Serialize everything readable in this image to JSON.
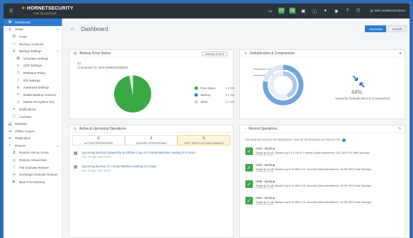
{
  "topbar": {
    "menu_icon": "hamburger-icon",
    "brand_name": "HORNETSECURITY",
    "brand_product": "VM BACKUP",
    "icons": [
      "monitor-icon",
      "cloud-icon",
      "console-icon",
      "info-icon",
      "bell-icon",
      "user-icon",
      "help-icon",
      "power-icon",
      "server-icon"
    ],
    "status_badge_1": "CP",
    "status_badge_2": "OK",
    "server_name": "WIN-20MB10OOEWI"
  },
  "sidebar": {
    "items": [
      {
        "label": "Dashboard",
        "icon": "dashboard-icon",
        "level": 1,
        "active": true,
        "chevron": ""
      },
      {
        "label": "Setup",
        "icon": "gear-icon",
        "level": 1,
        "active": false,
        "chevron": "▾"
      },
      {
        "label": "Hosts",
        "icon": "server-icon",
        "level": 2,
        "active": false,
        "chevron": ""
      },
      {
        "label": "Backup Locations",
        "icon": "folder-icon",
        "level": 2,
        "active": false,
        "chevron": ""
      },
      {
        "label": "Backup Settings",
        "icon": "gear-icon",
        "level": 2,
        "active": false,
        "chevron": "▾"
      },
      {
        "label": "Schedule Settings",
        "icon": "calendar-icon",
        "level": 3,
        "active": false,
        "chevron": ""
      },
      {
        "label": "CDP Settings",
        "icon": "refresh-icon",
        "level": 3,
        "active": false,
        "chevron": ""
      },
      {
        "label": "Retention Policy",
        "icon": "clock-icon",
        "level": 3,
        "active": false,
        "chevron": ""
      },
      {
        "label": "IFD Settings",
        "icon": "file-icon",
        "level": 3,
        "active": false,
        "chevron": ""
      },
      {
        "label": "Advanced Settings",
        "icon": "gear-icon",
        "level": 3,
        "active": false,
        "chevron": ""
      },
      {
        "label": "Delete Backup Versions",
        "icon": "trash-icon",
        "level": 3,
        "active": false,
        "chevron": ""
      },
      {
        "label": "Master Encryption Key",
        "icon": "key-icon",
        "level": 3,
        "active": false,
        "chevron": ""
      },
      {
        "label": "Notifications",
        "icon": "bell-icon",
        "level": 2,
        "active": false,
        "chevron": ""
      },
      {
        "label": "Licenses",
        "icon": "license-icon",
        "level": 2,
        "active": false,
        "chevron": ""
      },
      {
        "label": "Backups",
        "icon": "backup-icon",
        "level": 1,
        "active": false,
        "chevron": ""
      },
      {
        "label": "Offsite Copies",
        "icon": "cloud-icon",
        "level": 1,
        "active": false,
        "chevron": ""
      },
      {
        "label": "Replication",
        "icon": "replicate-icon",
        "level": 1,
        "active": false,
        "chevron": ""
      },
      {
        "label": "Restore",
        "icon": "restore-icon",
        "level": 1,
        "active": false,
        "chevron": "▾"
      },
      {
        "label": "Restore VM as Clone",
        "icon": "clone-icon",
        "level": 2,
        "active": false,
        "chevron": ""
      },
      {
        "label": "Restore Virtual Disk",
        "icon": "disk-icon",
        "level": 2,
        "active": false,
        "chevron": ""
      },
      {
        "label": "File Granular Restore",
        "icon": "file-icon",
        "level": 2,
        "active": false,
        "chevron": ""
      },
      {
        "label": "Exchange Granular Restore",
        "icon": "mail-icon",
        "level": 2,
        "active": false,
        "chevron": ""
      },
      {
        "label": "Boot From Backup",
        "icon": "boot-icon",
        "level": 2,
        "active": false,
        "chevron": ""
      }
    ]
  },
  "header": {
    "home_icon": "home-icon",
    "title": "Dashboard",
    "tabs": [
      {
        "label": "Overview",
        "active": true
      },
      {
        "label": "Details",
        "active": false
      }
    ]
  },
  "drive_status": {
    "title": "Backup Drive Status",
    "icon": "drive-icon",
    "dropdown_value": "Backup Drive",
    "drive_letter": "E:\\",
    "connected_to": "Connected To: WIN-20MB10OOEWI",
    "legend": [
      {
        "label": "Free Space",
        "value": "1.9 GB",
        "color": "#3aa845"
      },
      {
        "label": "Backup",
        "value": "0.1 GB",
        "color": "#2d7bd0"
      },
      {
        "label": "Other",
        "value": "1.1 GB",
        "color": "#c9ccd0"
      }
    ],
    "free_fraction": 0.97
  },
  "dedup": {
    "title": "Deduplication & Compression",
    "icon": "compress-icon",
    "label_processed": "Processed VM Data (8.1 GB)",
    "label_dedup": "Deduplication: 13.3 GB 44%",
    "percent": "44%",
    "percent_value": 44,
    "caption": "Saved by Deduplication & Compression",
    "arrows_icon": "arrows-in-icon"
  },
  "operations": {
    "title": "Active & Upcoming Operations",
    "icon": "clock-icon",
    "counts": [
      {
        "n": "0",
        "label": "ACTIVE OPERATIONS",
        "highlight": false
      },
      {
        "n": "0",
        "label": "QUEUED OPERATIONS",
        "highlight": false
      },
      {
        "n": "5",
        "label": "CDP / REPLICATION ENABLED",
        "highlight": true
      }
    ],
    "items": [
      {
        "title": "Upcoming Backup followed by an Offsite Copy of 5 Virtual Machines starting in 8 Hours",
        "date": "Thu, 10 Mar 2022 03:00"
      },
      {
        "title": "Upcoming Backup of 1 Virtual Machine starting in 2 Days",
        "date": "Sat, 12 Mar 2022 03:00"
      }
    ]
  },
  "recent": {
    "title": "Recent Operations",
    "icon": "history-icon",
    "refresh_icon": "refresh-icon",
    "note": "Showing last several VM Operations. View all VM Backups are listed in the",
    "items": [
      {
        "title": "VM2 - Backup",
        "desc": "Today at 11:45. Backed up 6.19 GB in 1 minute (Data transferred: 421 GB 47% Total Savings)",
        "id": "CDBA-18C3-E2A9"
      },
      {
        "title": "VM3 - Backup",
        "desc": "Today at 11:45. Backed up 6.04 MB in 21 seconds (Data transferred: 42 KB 99% Total Savings)",
        "id": "CDBA-18C3-E2A9"
      },
      {
        "title": "VM5 - Backup",
        "desc": "Today at 11:45. Backed up 6.04 MB in 51 seconds (Data transferred: 42 KB 99% Total Savings)",
        "id": "CDBA-18C3-E2A9"
      },
      {
        "title": "VM1 - Backup",
        "desc": "Today at 11:45. Backed up 6.04 MB in 21 seconds (Data transferred: 42 KB 99% Total Savings)",
        "id": "CDBA-18C3-E2A9"
      }
    ]
  }
}
